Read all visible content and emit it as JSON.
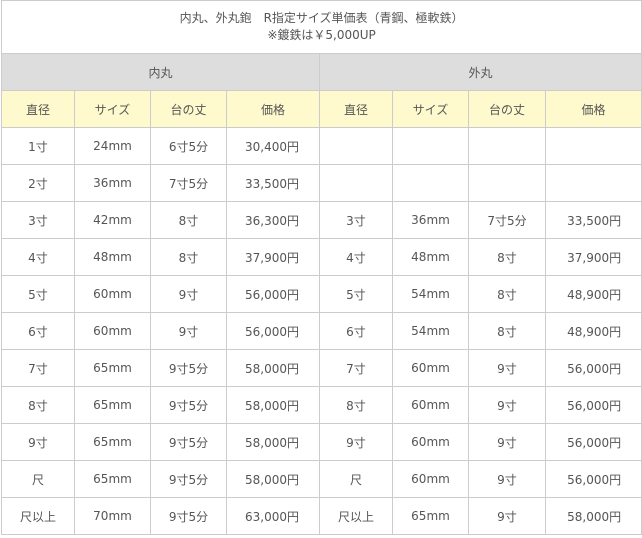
{
  "title": {
    "line1": "内丸、外丸鉋　R指定サイズ単価表（青鋼、極軟鉄）",
    "line2": "※鍍鉄は￥5,000UP"
  },
  "groups": {
    "inner": "内丸",
    "outer": "外丸"
  },
  "headers": [
    "直径",
    "サイズ",
    "台の丈",
    "価格",
    "直径",
    "サイズ",
    "台の丈",
    "価格"
  ],
  "rows": [
    [
      "1寸",
      "24mm",
      "6寸5分",
      "30,400円",
      "",
      "",
      "",
      ""
    ],
    [
      "2寸",
      "36mm",
      "7寸5分",
      "33,500円",
      "",
      "",
      "",
      ""
    ],
    [
      "3寸",
      "42mm",
      "8寸",
      "36,300円",
      "3寸",
      "36mm",
      "7寸5分",
      "33,500円"
    ],
    [
      "4寸",
      "48mm",
      "8寸",
      "37,900円",
      "4寸",
      "48mm",
      "8寸",
      "37,900円"
    ],
    [
      "5寸",
      "60mm",
      "9寸",
      "56,000円",
      "5寸",
      "54mm",
      "8寸",
      "48,900円"
    ],
    [
      "6寸",
      "60mm",
      "9寸",
      "56,000円",
      "6寸",
      "54mm",
      "8寸",
      "48,900円"
    ],
    [
      "7寸",
      "65mm",
      "9寸5分",
      "58,000円",
      "7寸",
      "60mm",
      "9寸",
      "56,000円"
    ],
    [
      "8寸",
      "65mm",
      "9寸5分",
      "58,000円",
      "8寸",
      "60mm",
      "9寸",
      "56,000円"
    ],
    [
      "9寸",
      "65mm",
      "9寸5分",
      "58,000円",
      "9寸",
      "60mm",
      "9寸",
      "56,000円"
    ],
    [
      "尺",
      "65mm",
      "9寸5分",
      "58,000円",
      "尺",
      "60mm",
      "9寸",
      "56,000円"
    ],
    [
      "尺以上",
      "70mm",
      "9寸5分",
      "63,000円",
      "尺以上",
      "65mm",
      "9寸",
      "58,000円"
    ]
  ]
}
